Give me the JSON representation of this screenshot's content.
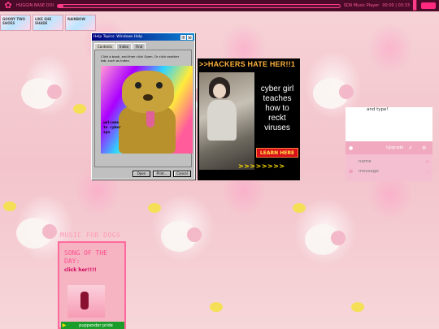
{
  "topbar": {
    "track_label": "HUGGIN BASE DOI",
    "player_name": "SDR Music Player",
    "time": "00:00 | 03:33",
    "progress": 0.02
  },
  "stickers": [
    {
      "label": "GOODY TWO SHOES"
    },
    {
      "label": "LIKE SHE SHADE"
    },
    {
      "label": "RAINBOW"
    }
  ],
  "help_window": {
    "title": "Help Topics: Windows Help",
    "tabs": [
      "Contents",
      "Index",
      "Find"
    ],
    "instructions": "Click a book, and then click Open. Or click another tab, such as Index.",
    "image_caption": "welcome to cyber spa",
    "buttons": {
      "open": "Open",
      "print": "Print...",
      "cancel": "Cancel"
    }
  },
  "ad": {
    "headline": ">>HACKERS HATE HER!!1",
    "copy": "cyber girl teaches how to reckt viruses",
    "cta": "LEARN HERE",
    "arrows": ">>>>>>>>"
  },
  "chat": {
    "fragment": "and type!",
    "upgrade": "Upgrade",
    "name_placeholder": "name",
    "message_placeholder": "message"
  },
  "music": {
    "heading": "MUSIC FOR DOGS",
    "song_heading": "SONG OF THE DAY:",
    "link": "click her!!!!",
    "track": "puppender pride"
  },
  "colors": {
    "accent": "#ff3c88",
    "chat_bar": "#f0a9bf",
    "ad_cta": "#d90f1a",
    "music_border": "#ff6a9e",
    "player_bar": "#1a9d2b"
  }
}
